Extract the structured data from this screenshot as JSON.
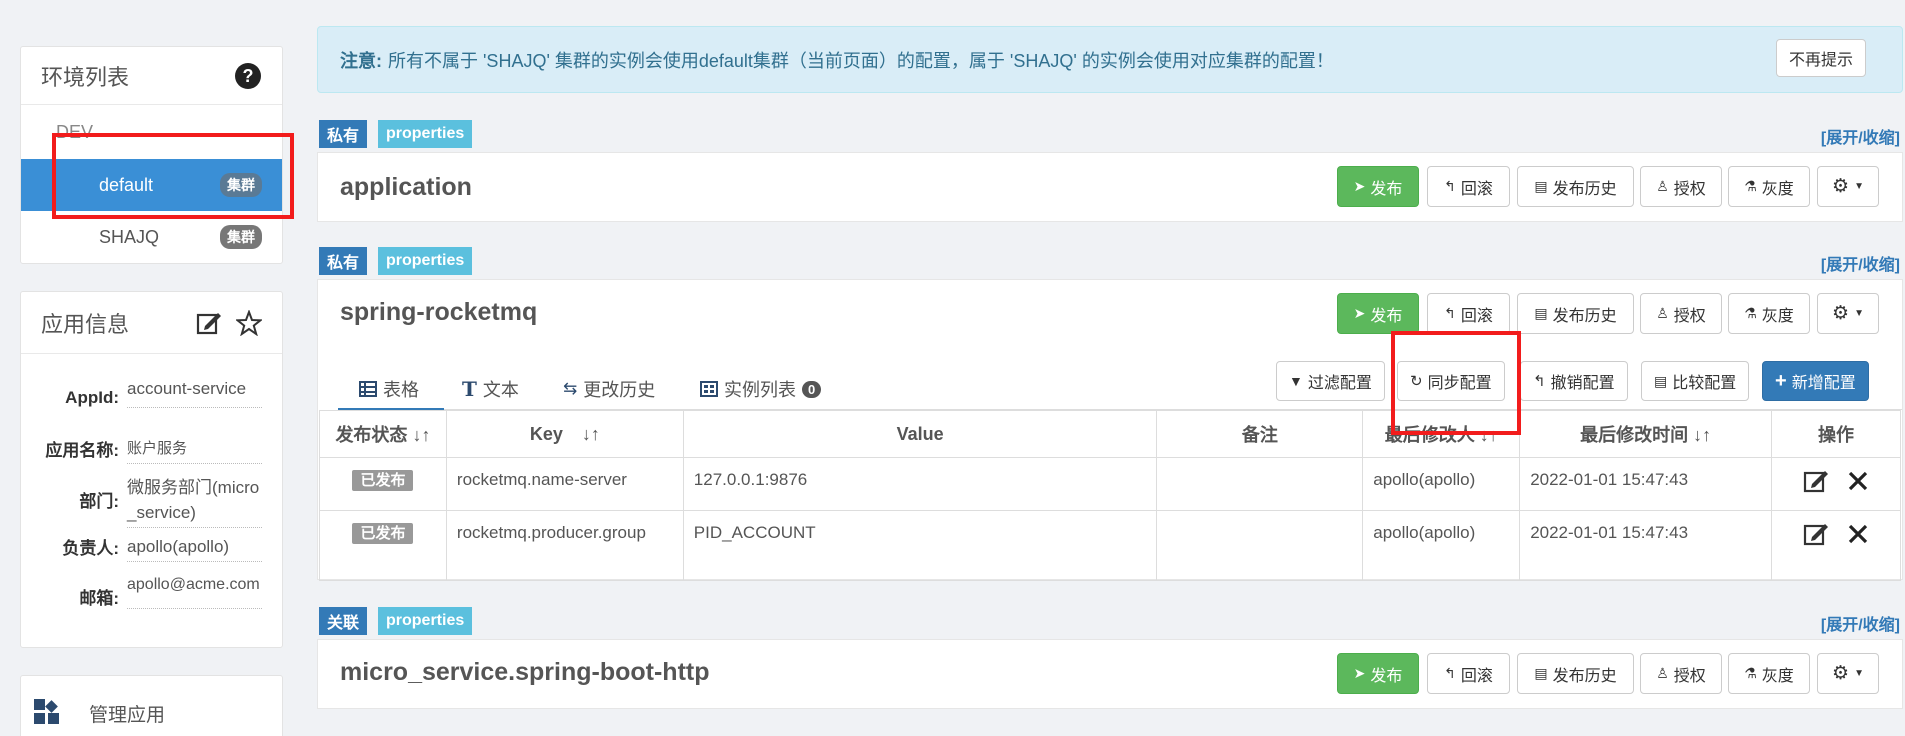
{
  "env_panel": {
    "title": "环境列表",
    "env": "DEV",
    "clusters": [
      {
        "name": "default",
        "badge": "集群"
      },
      {
        "name": "SHAJQ",
        "badge": "集群"
      }
    ]
  },
  "app_panel": {
    "title": "应用信息",
    "rows": [
      {
        "label": "AppId:",
        "value": "account-service"
      },
      {
        "label": "应用名称:",
        "value": "账户服务"
      },
      {
        "label": "部门:",
        "value": "微服务部门(micro_service)"
      },
      {
        "label": "负责人:",
        "value": "apollo(apollo)"
      },
      {
        "label": "邮箱:",
        "value": "apollo@acme.com"
      }
    ]
  },
  "manage": {
    "label": "管理应用"
  },
  "notice": {
    "prefix": "注意:",
    "text": "所有不属于 'SHAJQ' 集群的实例会使用default集群（当前页面）的配置，属于 'SHAJQ' 的实例会使用对应集群的配置！",
    "dismiss": "不再提示"
  },
  "actions": {
    "publish": "发布",
    "rollback": "回滚",
    "history": "发布历史",
    "auth": "授权",
    "gray": "灰度"
  },
  "expand_label": "[展开/收缩]",
  "namespaces": [
    {
      "scope": "私有",
      "format": "properties",
      "name": "application"
    },
    {
      "scope": "私有",
      "format": "properties",
      "name": "spring-rocketmq"
    },
    {
      "scope": "关联",
      "format": "properties",
      "name": "micro_service.spring-boot-http"
    }
  ],
  "tabs": {
    "table": "表格",
    "text": "文本",
    "history": "更改历史",
    "instances": "实例列表",
    "instance_count": "0"
  },
  "toolbar": {
    "filter": "过滤配置",
    "sync": "同步配置",
    "revoke": "撤销配置",
    "compare": "比较配置",
    "add": "新增配置"
  },
  "table": {
    "headers": [
      "发布状态",
      "Key",
      "Value",
      "备注",
      "最后修改人",
      "最后修改时间",
      "操作"
    ],
    "rows": [
      {
        "status": "已发布",
        "key": "rocketmq.name-server",
        "value": "127.0.0.1:9876",
        "comment": "",
        "modifier": "apollo(apollo)",
        "time": "2022-01-01 15:47:43"
      },
      {
        "status": "已发布",
        "key": "rocketmq.producer.group",
        "value": "PID_ACCOUNT",
        "comment": "",
        "modifier": "apollo(apollo)",
        "time": "2022-01-01 15:47:43"
      }
    ]
  },
  "colors": {
    "highlight": "#f21c1c",
    "active": "#3a8fd6",
    "publish": "#5cb85c"
  }
}
